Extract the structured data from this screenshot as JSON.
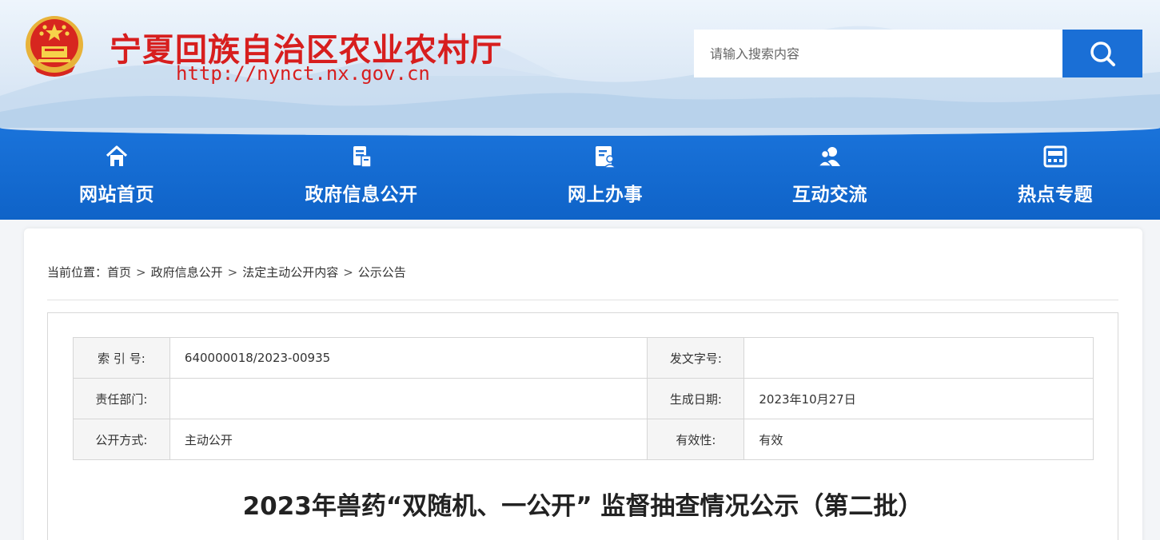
{
  "header": {
    "site_title": "宁夏回族自治区农业农村厅",
    "site_url": "http://nynct.nx.gov.cn",
    "search_placeholder": "请输入搜索内容"
  },
  "nav": {
    "items": [
      {
        "label": "网站首页",
        "icon": "home-icon"
      },
      {
        "label": "政府信息公开",
        "icon": "document-icon"
      },
      {
        "label": "网上办事",
        "icon": "online-service-icon"
      },
      {
        "label": "互动交流",
        "icon": "users-icon"
      },
      {
        "label": "热点专题",
        "icon": "topic-board-icon"
      }
    ]
  },
  "breadcrumb": {
    "prefix": "当前位置：",
    "items": [
      "首页",
      "政府信息公开",
      "法定主动公开内容",
      "公示公告"
    ],
    "separator": ">"
  },
  "meta_table": {
    "index_label": "索 引 号:",
    "index_value": "640000018/2023-00935",
    "doc_no_label": "发文字号:",
    "doc_no_value": "",
    "dept_label": "责任部门:",
    "dept_value": "",
    "date_label": "生成日期:",
    "date_value": "2023年10月27日",
    "mode_label": "公开方式:",
    "mode_value": "主动公开",
    "validity_label": "有效性:",
    "validity_value": "有效"
  },
  "article": {
    "title": "2023年兽药“双随机、一公开” 监督抽查情况公示（第二批）"
  },
  "colors": {
    "brand_red": "#d71e1e",
    "nav_blue": "#1a6fd6"
  }
}
